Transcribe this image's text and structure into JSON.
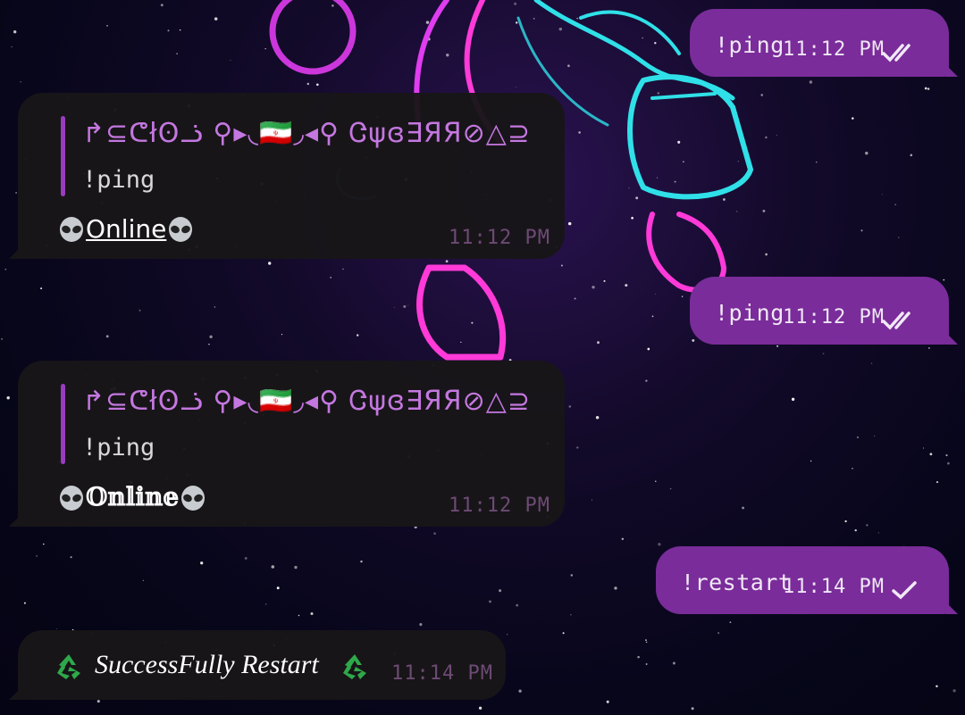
{
  "colors": {
    "outgoing_bubble": "#7a2c9a",
    "incoming_bubble": "#181618",
    "quote_accent": "#9a3cc0",
    "quote_name": "#c477e0",
    "incoming_time": "#6d4a74"
  },
  "messages": [
    {
      "direction": "outgoing",
      "text": "!ping",
      "time": "11:12 PM",
      "status": "read-double-check"
    },
    {
      "direction": "incoming",
      "reply_to_name": "↱⊆ᕦłʘᓘ ⚲▸◟🇮🇷◞◂⚲ Ꮳψɞ∃ЯЯ⊘△⊇",
      "reply_to_text": "!ping",
      "text": "Online",
      "text_style": "underlined-arrows",
      "emoji": "alien",
      "time": "11:12 PM"
    },
    {
      "direction": "outgoing",
      "text": "!ping",
      "time": "11:12 PM",
      "status": "read-double-check"
    },
    {
      "direction": "incoming",
      "reply_to_name": "↱⊆ᕦłʘᓘ ⚲▸◟🇮🇷◞◂⚲ Ꮳψɞ∃ЯЯ⊘△⊇",
      "reply_to_text": "!ping",
      "text": "𝕆𝕟𝕝𝕚𝕟𝕖",
      "text_style": "double-struck",
      "emoji": "alien",
      "time": "11:12 PM"
    },
    {
      "direction": "outgoing",
      "text": "!restart",
      "time": "11:14 PM",
      "status": "sent-single-check"
    },
    {
      "direction": "incoming",
      "text": "SuccessFully Restart",
      "emoji": "recycle",
      "time": "11:14 PM"
    }
  ]
}
